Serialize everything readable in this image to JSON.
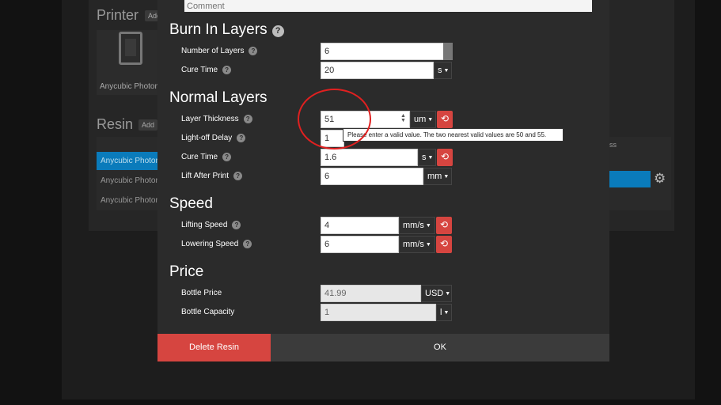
{
  "background": {
    "printer_title": "Printer",
    "printer_add": "Add",
    "printer_name": "Anycubic Photon",
    "resin_title": "Resin",
    "resin_add": "Add",
    "resin_rows": [
      "Anycubic Photon",
      "Anycubic Photon",
      "Anycubic Photon"
    ],
    "col_header_fragment": "ss"
  },
  "comment": {
    "placeholder": "Comment"
  },
  "sections": {
    "burn_in": "Burn In Layers",
    "normal": "Normal Layers",
    "speed": "Speed",
    "price": "Price"
  },
  "burn_in": {
    "num_layers_label": "Number of Layers",
    "num_layers_value": "6",
    "cure_time_label": "Cure Time",
    "cure_time_value": "20",
    "cure_time_unit": "s"
  },
  "normal": {
    "layer_thickness_label": "Layer Thickness",
    "layer_thickness_value": "51",
    "layer_thickness_unit": "um",
    "light_off_label": "Light-off Delay",
    "light_off_value": "1",
    "cure_time_label": "Cure Time",
    "cure_time_value": "1.6",
    "cure_time_unit": "s",
    "lift_label": "Lift After Print",
    "lift_value": "6",
    "lift_unit": "mm"
  },
  "speed": {
    "lifting_label": "Lifting Speed",
    "lifting_value": "4",
    "lifting_unit": "mm/s",
    "lowering_label": "Lowering Speed",
    "lowering_value": "6",
    "lowering_unit": "mm/s"
  },
  "price": {
    "bottle_price_label": "Bottle Price",
    "bottle_price_value": "41.99",
    "bottle_price_unit": "USD",
    "capacity_label": "Bottle Capacity",
    "capacity_value": "1",
    "capacity_unit": "l"
  },
  "tooltip": "Please enter a valid value. The two nearest valid values are 50 and 55.",
  "footer": {
    "delete": "Delete Resin",
    "ok": "OK"
  },
  "colors": {
    "accent_red": "#d64540",
    "select_blue": "#0a7bbb",
    "annotation_red": "#e02020"
  }
}
